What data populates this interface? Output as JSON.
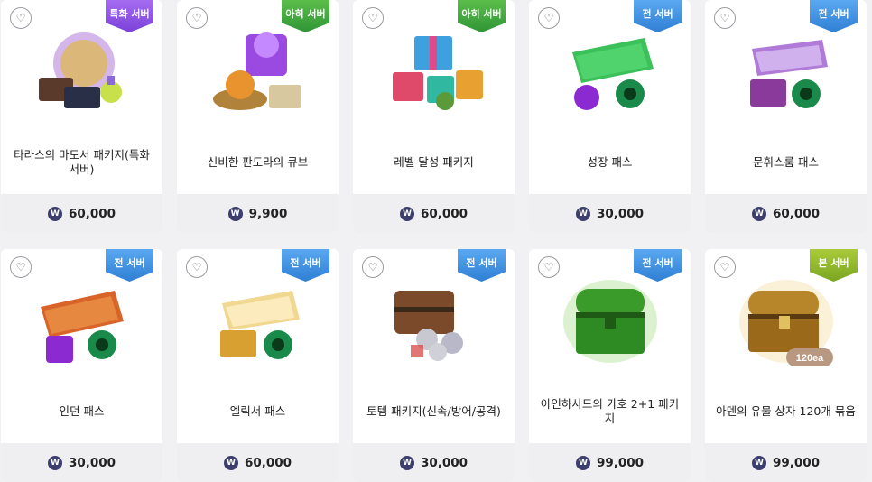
{
  "colors": {
    "badge_purple": "#8a52e0",
    "badge_green": "#3aa03c",
    "badge_blue": "#3d8fe0",
    "badge_lime": "#8ab52c",
    "coin": "#3c3f6e"
  },
  "currency_symbol": "W",
  "products": [
    {
      "badge": "특화 서버",
      "badge_color": "purple",
      "title": "타라스의 마도서 패키지(특화 서버)",
      "price": "60,000",
      "icon": "magic-tome-orb-icon"
    },
    {
      "badge": "아히 서버",
      "badge_color": "green",
      "title": "신비한 판도라의 큐브",
      "price": "9,900",
      "icon": "mystic-cube-icon"
    },
    {
      "badge": "아히 서버",
      "badge_color": "green",
      "title": "레벨 달성 패키지",
      "price": "60,000",
      "icon": "gift-boxes-icon"
    },
    {
      "badge": "전 서버",
      "badge_color": "blue",
      "title": "성장 패스",
      "price": "30,000",
      "icon": "green-ticket-icon"
    },
    {
      "badge": "전 서버",
      "badge_color": "blue",
      "title": "문휘스룸 패스",
      "price": "60,000",
      "icon": "purple-ticket-icon"
    },
    {
      "badge": "전 서버",
      "badge_color": "blue",
      "title": "인던 패스",
      "price": "30,000",
      "icon": "dungeon-ticket-icon"
    },
    {
      "badge": "전 서버",
      "badge_color": "blue",
      "title": "엘릭서 패스",
      "price": "60,000",
      "icon": "gold-ticket-icon"
    },
    {
      "badge": "전 서버",
      "badge_color": "blue",
      "title": "토템 패키지(신속/방어/공격)",
      "price": "30,000",
      "icon": "totem-chest-icon"
    },
    {
      "badge": "전 서버",
      "badge_color": "blue",
      "title": "아인하사드의 가호 2+1 패키지",
      "price": "99,000",
      "icon": "green-chest-icon"
    },
    {
      "badge": "본 서버",
      "badge_color": "lime",
      "title": "아덴의 유물 상자 120개 묶음",
      "price": "99,000",
      "icon": "golden-chest-icon",
      "image_label": "120ea"
    }
  ]
}
